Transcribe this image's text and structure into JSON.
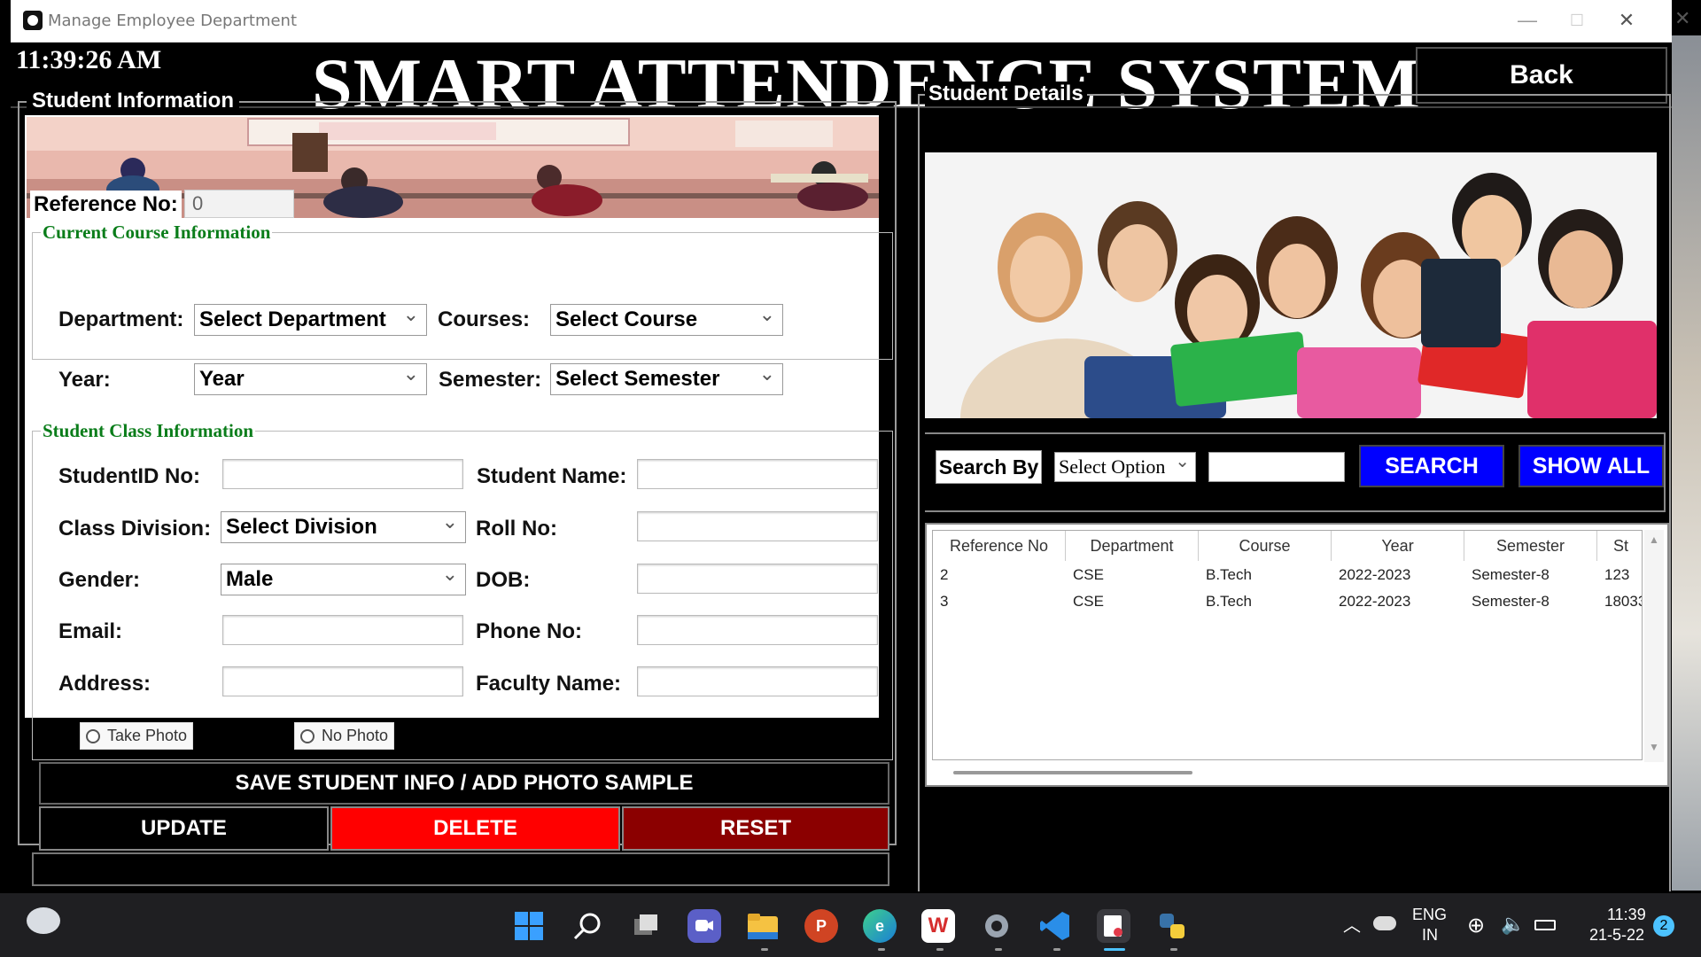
{
  "window": {
    "title": "Manage Employee Department",
    "minimize": "—",
    "maximize": "☐",
    "close": "✕"
  },
  "header": {
    "clock": "11:39:26 AM",
    "title": "SMART ATTENDENCE SYSTEM",
    "back_label": "Back"
  },
  "student_info": {
    "legend": "Student Information",
    "reference_label": "Reference  No:",
    "reference_value": "0",
    "course_section": {
      "legend": "Current Course Information",
      "department_label": "Department:",
      "department_value": "Select Department",
      "courses_label": "Courses:",
      "courses_value": "Select Course",
      "year_label": "Year:",
      "year_value": "Year",
      "semester_label": "Semester:",
      "semester_value": "Select Semester"
    },
    "class_section": {
      "legend": "Student Class Information",
      "student_id_label": "StudentID No:",
      "student_name_label": "Student Name:",
      "class_division_label": "Class Division:",
      "class_division_value": "Select Division",
      "roll_no_label": "Roll No:",
      "gender_label": "Gender:",
      "gender_value": "Male",
      "dob_label": "DOB:",
      "email_label": "Email:",
      "phone_label": "Phone No:",
      "address_label": "Address:",
      "faculty_label": "Faculty Name:",
      "take_photo": "Take Photo",
      "no_photo": "No Photo"
    },
    "buttons": {
      "save": "SAVE STUDENT INFO / ADD PHOTO SAMPLE",
      "update": "UPDATE",
      "delete": "DELETE",
      "reset": "RESET"
    }
  },
  "student_details": {
    "legend": "Student Details",
    "search_by_label": "Search By",
    "search_option": "Select Option",
    "search_button": "SEARCH",
    "show_all_button": "SHOW ALL",
    "columns": [
      "Reference No",
      "Department",
      "Course",
      "Year",
      "Semester",
      "St"
    ],
    "rows": [
      [
        "2",
        "CSE",
        "B.Tech",
        "2022-2023",
        "Semester-8",
        "123"
      ],
      [
        "3",
        "CSE",
        "B.Tech",
        "2022-2023",
        "Semester-8",
        "18033"
      ]
    ]
  },
  "taskbar": {
    "language_top": "ENG",
    "language_bottom": "IN",
    "time": "11:39",
    "date": "21-5-22",
    "notification_count": "2"
  },
  "colors": {
    "delete": "#ff0000",
    "reset": "#8b0000",
    "search": "#0000ff",
    "section_legend": "#0a7d1a"
  }
}
